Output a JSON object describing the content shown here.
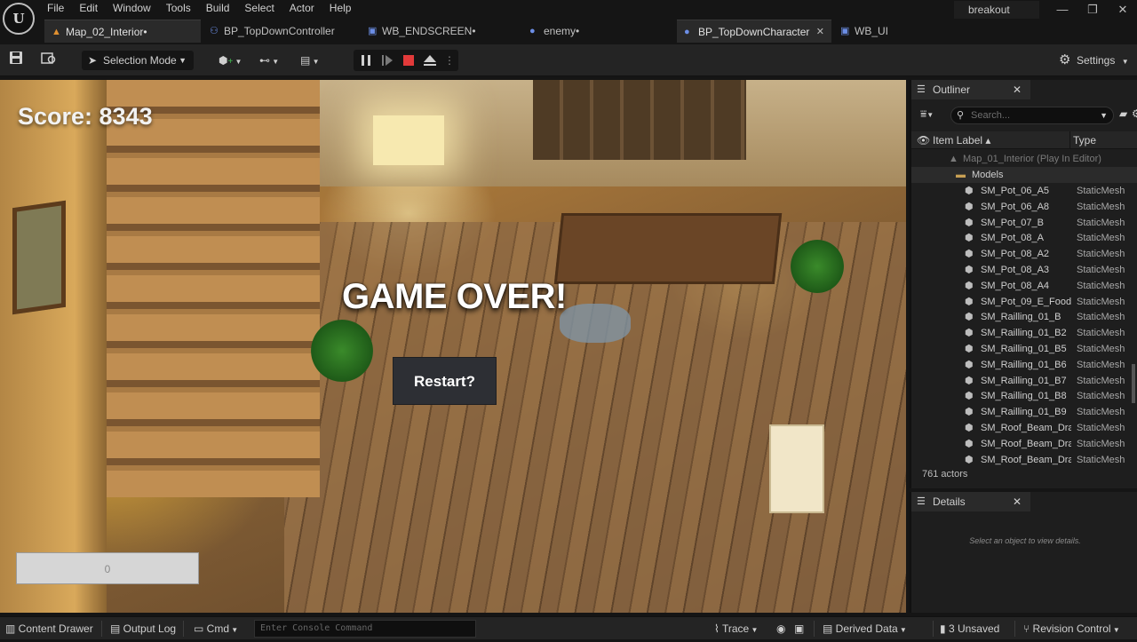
{
  "menu": {
    "logo": "U",
    "items": [
      "File",
      "Edit",
      "Window",
      "Tools",
      "Build",
      "Select",
      "Actor",
      "Help"
    ],
    "project": "breakout"
  },
  "tabs": [
    {
      "label": "Map_02_Interior•",
      "icon": "map-icon",
      "active": false
    },
    {
      "label": "BP_TopDownController",
      "icon": "gamepad-icon",
      "active": false
    },
    {
      "label": "WB_ENDSCREEN•",
      "icon": "widget-icon",
      "active": false
    },
    {
      "label": "enemy•",
      "icon": "character-icon",
      "active": false
    },
    {
      "label": "BP_TopDownCharacter",
      "icon": "character-icon",
      "active": true
    },
    {
      "label": "WB_UI",
      "icon": "widget-icon",
      "active": false
    }
  ],
  "toolbar": {
    "selection_mode": "Selection Mode",
    "settings": "Settings"
  },
  "viewport": {
    "score": "Score: 8343",
    "game_over": "GAME OVER!",
    "restart": "Restart?",
    "hud_bar_value": "0"
  },
  "outliner": {
    "title": "Outliner",
    "search_placeholder": "Search...",
    "col_label": "Item Label ▴",
    "col_type": "Type",
    "root": "Map_01_Interior (Play In Editor)",
    "folder": "Models",
    "rows": [
      {
        "label": "SM_Pot_06_A5",
        "type": "StaticMesh"
      },
      {
        "label": "SM_Pot_06_A8",
        "type": "StaticMesh"
      },
      {
        "label": "SM_Pot_07_B",
        "type": "StaticMesh"
      },
      {
        "label": "SM_Pot_08_A",
        "type": "StaticMesh"
      },
      {
        "label": "SM_Pot_08_A2",
        "type": "StaticMesh"
      },
      {
        "label": "SM_Pot_08_A3",
        "type": "StaticMesh"
      },
      {
        "label": "SM_Pot_08_A4",
        "type": "StaticMesh"
      },
      {
        "label": "SM_Pot_09_E_Food",
        "type": "StaticMesh"
      },
      {
        "label": "SM_Railling_01_B",
        "type": "StaticMesh"
      },
      {
        "label": "SM_Railling_01_B2",
        "type": "StaticMesh"
      },
      {
        "label": "SM_Railling_01_B5",
        "type": "StaticMesh"
      },
      {
        "label": "SM_Railling_01_B6",
        "type": "StaticMesh"
      },
      {
        "label": "SM_Railling_01_B7",
        "type": "StaticMesh"
      },
      {
        "label": "SM_Railling_01_B8",
        "type": "StaticMesh"
      },
      {
        "label": "SM_Railling_01_B9",
        "type": "StaticMesh"
      },
      {
        "label": "SM_Roof_Beam_Dra",
        "type": "StaticMesh"
      },
      {
        "label": "SM_Roof_Beam_Dra",
        "type": "StaticMesh"
      },
      {
        "label": "SM_Roof_Beam_Dra",
        "type": "StaticMesh"
      }
    ],
    "actor_count": "761 actors"
  },
  "details": {
    "title": "Details",
    "empty_message": "Select an object to view details."
  },
  "statusbar": {
    "content_drawer": "Content Drawer",
    "output_log": "Output Log",
    "cmd": "Cmd",
    "console_placeholder": "Enter Console Command",
    "trace": "Trace",
    "derived_data": "Derived Data",
    "unsaved": "3 Unsaved",
    "revision_control": "Revision Control"
  }
}
